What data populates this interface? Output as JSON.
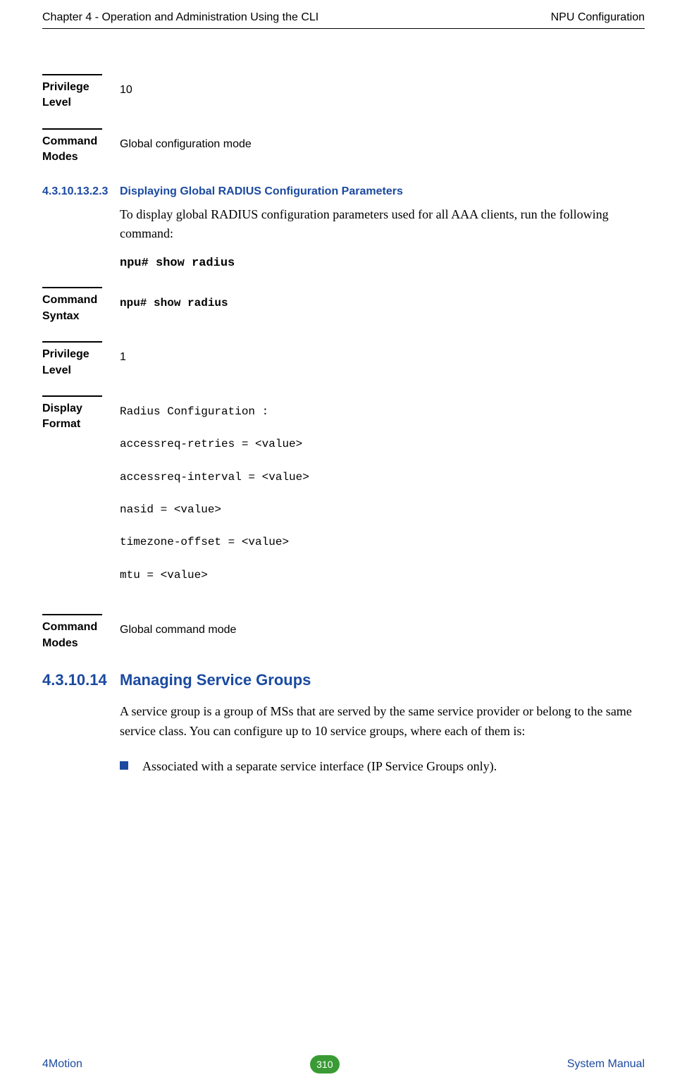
{
  "header": {
    "left": "Chapter 4 - Operation and Administration Using the CLI",
    "right": "NPU Configuration"
  },
  "blocks": {
    "privilege10": {
      "label": "Privilege Level",
      "value": "10"
    },
    "cmdModesGlobalConfig": {
      "label": "Command Modes",
      "value": "Global configuration mode"
    },
    "sec4310_13_2_3": {
      "num": "4.3.10.13.2.3",
      "title": "Displaying Global RADIUS Configuration Parameters",
      "body": "To display global RADIUS configuration parameters used for all AAA clients, run the following command:",
      "cmd": "npu# show radius"
    },
    "cmdSyntax": {
      "label": "Command Syntax",
      "value": "npu# show radius"
    },
    "privilege1": {
      "label": "Privilege Level",
      "value": "1"
    },
    "displayFormat": {
      "label": "Display Format",
      "lines": [
        "Radius Configuration :",
        "accessreq-retries = <value>",
        "accessreq-interval = <value>",
        "nasid = <value>",
        "timezone-offset = <value>",
        "mtu = <value>"
      ]
    },
    "cmdModesGlobalCmd": {
      "label": "Command Modes",
      "value": "Global command mode"
    },
    "sec4310_14": {
      "num": "4.3.10.14",
      "title": "Managing Service Groups",
      "body": "A service group is a group of MSs that are served by the same service provider or belong to the same service class. You can configure up to 10 service groups, where each of them is:",
      "bullet1": "Associated with a separate service interface (IP Service Groups only)."
    }
  },
  "footer": {
    "left": "4Motion",
    "pageNumber": "310",
    "right": "System Manual"
  }
}
